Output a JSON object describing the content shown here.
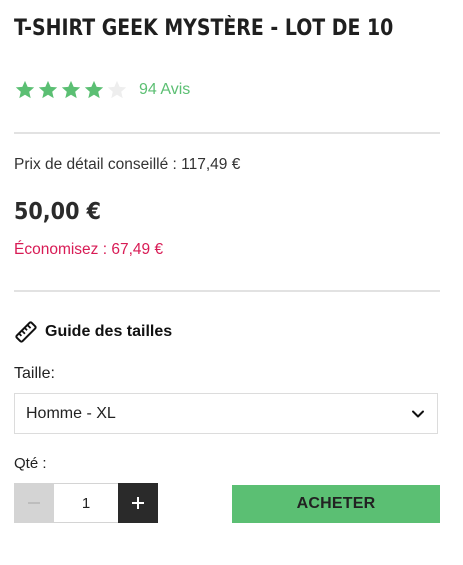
{
  "product": {
    "title": "T-SHIRT GEEK MYSTÈRE - LOT DE 10",
    "rating": {
      "stars_filled": 4,
      "stars_total": 5,
      "reviews_label": "94 Avis"
    }
  },
  "pricing": {
    "msrp_text": "Prix de détail conseillé : 117,49 €",
    "price": "50,00 €",
    "savings_text": "Économisez : 67,49 €"
  },
  "size_guide": {
    "label": "Guide des tailles",
    "icon": "ruler-icon"
  },
  "size": {
    "label": "Taille:",
    "selected": "Homme - XL",
    "icon": "chevron-down-icon"
  },
  "quantity": {
    "label": "Qté :",
    "value": "1",
    "minus_icon": "minus-icon",
    "plus_icon": "plus-icon"
  },
  "buy_button": {
    "label": "ACHETER"
  },
  "colors": {
    "accent_green": "#5bbf73",
    "savings_red": "#d81b55",
    "star_empty": "#eeeeee",
    "plus_bg": "#2a2a2a",
    "minus_bg": "#d4d4d4"
  }
}
